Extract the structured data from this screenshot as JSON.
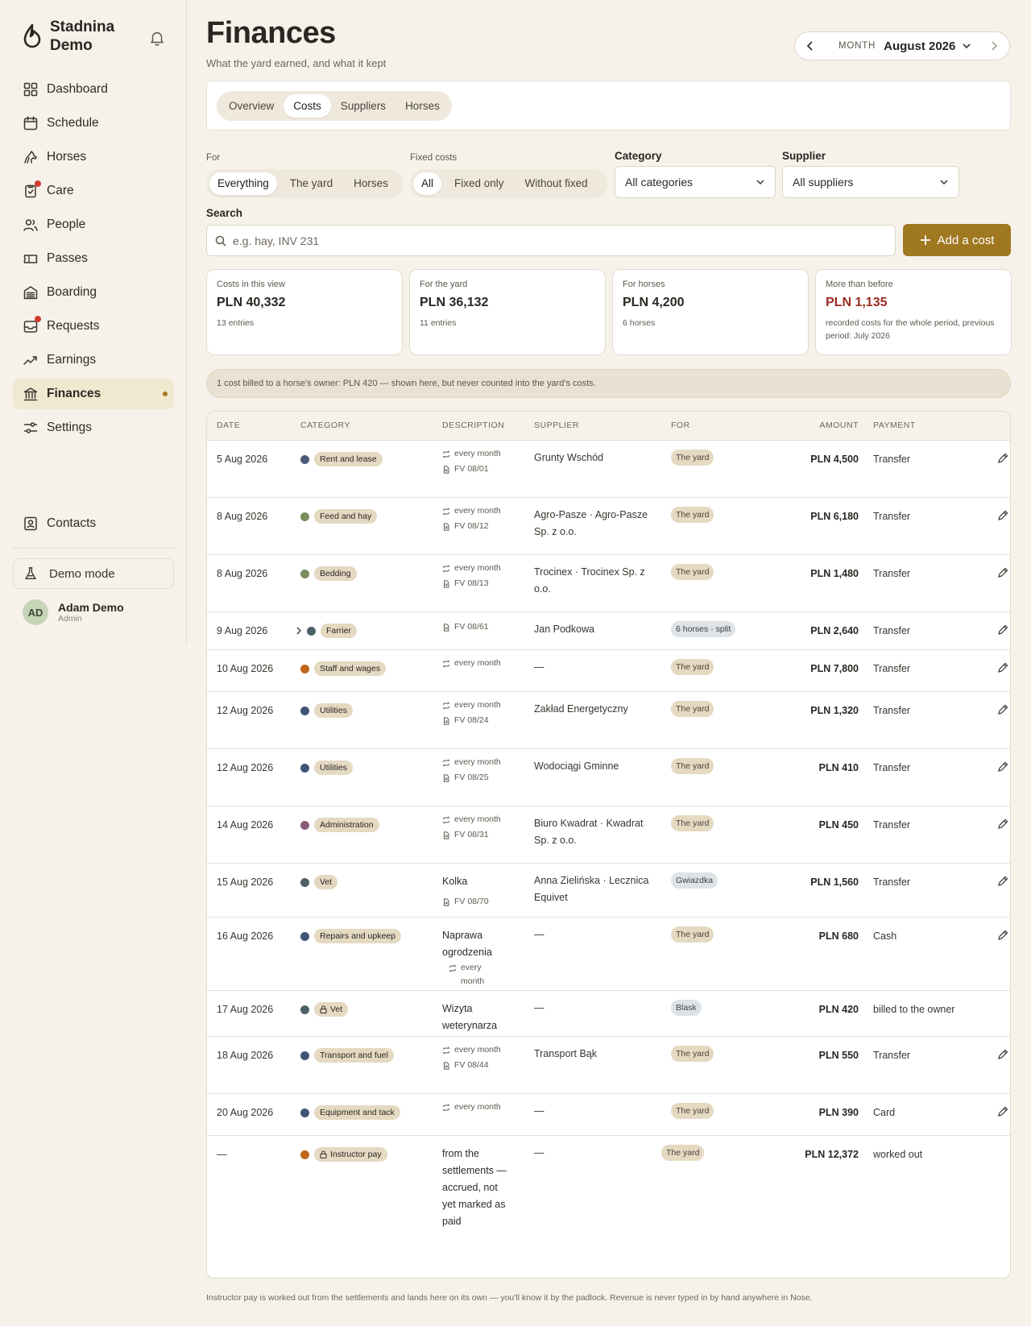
{
  "app": {
    "name": "Stadnina Demo"
  },
  "sidebar": {
    "items": [
      {
        "label": "Dashboard",
        "icon": "grid-icon"
      },
      {
        "label": "Schedule",
        "icon": "calendar-icon"
      },
      {
        "label": "Horses",
        "icon": "horse-icon"
      },
      {
        "label": "Care",
        "icon": "clipboard-icon"
      },
      {
        "label": "People",
        "icon": "people-icon"
      },
      {
        "label": "Passes",
        "icon": "ticket-icon"
      },
      {
        "label": "Boarding",
        "icon": "barn-icon"
      },
      {
        "label": "Requests",
        "icon": "inbox-icon"
      },
      {
        "label": "Earnings",
        "icon": "trend-icon"
      },
      {
        "label": "Finances",
        "icon": "bank-icon"
      },
      {
        "label": "Settings",
        "icon": "sliders-icon"
      }
    ],
    "contacts": "Contacts",
    "demo_mode": "Demo mode",
    "user": {
      "initials": "AD",
      "name": "Adam Demo",
      "role": "Admin"
    }
  },
  "header": {
    "title": "Finances",
    "subtitle": "What the yard earned, and what it kept",
    "month_label": "MONTH",
    "month_value": "August 2026"
  },
  "tabs": [
    "Overview",
    "Costs",
    "Suppliers",
    "Horses"
  ],
  "filters": {
    "for_label": "For",
    "for_options": [
      "Everything",
      "The yard",
      "Horses"
    ],
    "fixed_label": "Fixed costs",
    "fixed_options": [
      "All",
      "Fixed only",
      "Without fixed"
    ],
    "category_label": "Category",
    "category_value": "All categories",
    "supplier_label": "Supplier",
    "supplier_value": "All suppliers",
    "search_label": "Search",
    "search_placeholder": "e.g. hay, INV 231",
    "add_button": "Add a cost"
  },
  "stats": [
    {
      "label": "Costs in this view",
      "value": "PLN 40,332",
      "note": "13 entries"
    },
    {
      "label": "For the yard",
      "value": "PLN 36,132",
      "note": "11 entries"
    },
    {
      "label": "For horses",
      "value": "PLN 4,200",
      "note": "6 horses"
    },
    {
      "label": "More than before",
      "value": "PLN 1,135",
      "note": "recorded costs for the whole period, previous period: July 2026"
    }
  ],
  "banner": "1 cost billed to a horse's owner: PLN 420 — shown here, but never counted into the yard's costs.",
  "table": {
    "headers": [
      "DATE",
      "CATEGORY",
      "DESCRIPTION",
      "SUPPLIER",
      "FOR",
      "AMOUNT",
      "PAYMENT"
    ],
    "recurring": "every month",
    "rows": [
      {
        "date": "5 Aug 2026",
        "category": "Rent and lease",
        "color": "#4a5a78",
        "desc": "",
        "recurring": true,
        "invoice": "FV 08/01",
        "supplier": "Grunty Wschód",
        "for": "The yard",
        "for_type": "yard",
        "amount": "PLN 4,500",
        "payment": "Transfer"
      },
      {
        "date": "8 Aug 2026",
        "category": "Feed and hay",
        "color": "#7a8c5c",
        "desc": "",
        "recurring": true,
        "invoice": "FV 08/12",
        "supplier": "Agro-Pasze · Agro-Pasze Sp. z o.o.",
        "for": "The yard",
        "for_type": "yard",
        "amount": "PLN 6,180",
        "payment": "Transfer"
      },
      {
        "date": "8 Aug 2026",
        "category": "Bedding",
        "color": "#7a8c5c",
        "desc": "",
        "recurring": true,
        "invoice": "FV 08/13",
        "supplier": "Trocinex · Trocinex Sp. z o.o.",
        "for": "The yard",
        "for_type": "yard",
        "amount": "PLN 1,480",
        "payment": "Transfer"
      },
      {
        "date": "9 Aug 2026",
        "category": "Farrier",
        "color": "#4d6068",
        "desc": "",
        "recurring": false,
        "invoice": "FV 08/61",
        "supplier": "Jan Podkowa",
        "for": "6 horses · split",
        "for_type": "horse",
        "amount": "PLN 2,640",
        "payment": "Transfer"
      },
      {
        "date": "10 Aug 2026",
        "category": "Staff and wages",
        "color": "#c0661c",
        "desc": "",
        "recurring": true,
        "invoice": "",
        "supplier": "—",
        "for": "The yard",
        "for_type": "yard",
        "amount": "PLN 7,800",
        "payment": "Transfer"
      },
      {
        "date": "12 Aug 2026",
        "category": "Utilities",
        "color": "#3f5478",
        "desc": "",
        "recurring": true,
        "invoice": "FV 08/24",
        "supplier": "Zakład Energetyczny",
        "for": "The yard",
        "for_type": "yard",
        "amount": "PLN 1,320",
        "payment": "Transfer"
      },
      {
        "date": "12 Aug 2026",
        "category": "Utilities",
        "color": "#3f5478",
        "desc": "",
        "recurring": true,
        "invoice": "FV 08/25",
        "supplier": "Wodociągi Gminne",
        "for": "The yard",
        "for_type": "yard",
        "amount": "PLN 410",
        "payment": "Transfer"
      },
      {
        "date": "14 Aug 2026",
        "category": "Administration",
        "color": "#8a5c78",
        "desc": "",
        "recurring": true,
        "invoice": "FV 08/31",
        "supplier": "Biuro Kwadrat · Kwadrat Sp. z o.o.",
        "for": "The yard",
        "for_type": "yard",
        "amount": "PLN 450",
        "payment": "Transfer"
      },
      {
        "date": "15 Aug 2026",
        "category": "Vet",
        "color": "#4d6068",
        "desc": "Kolka",
        "recurring": false,
        "invoice": "FV 08/70",
        "supplier": "Anna Zielińska · Lecznica Equivet",
        "for": "Gwiazdka",
        "for_type": "horse",
        "amount": "PLN 1,560",
        "payment": "Transfer"
      },
      {
        "date": "16 Aug 2026",
        "category": "Repairs and upkeep",
        "color": "#3f5478",
        "desc": "Naprawa ogrodzenia",
        "recurring": true,
        "invoice": "",
        "supplier": "—",
        "for": "The yard",
        "for_type": "yard",
        "amount": "PLN 680",
        "payment": "Cash"
      },
      {
        "date": "17 Aug 2026",
        "category": "Vet",
        "color": "#4d6068",
        "lock": true,
        "desc": "Wizyta weterynarza",
        "recurring": false,
        "invoice": "",
        "supplier": "—",
        "for": "Blask",
        "for_type": "horse",
        "amount": "PLN 420",
        "payment": "billed to the owner",
        "no_edit": true
      },
      {
        "date": "18 Aug 2026",
        "category": "Transport and fuel",
        "color": "#3f5478",
        "desc": "",
        "recurring": true,
        "invoice": "FV 08/44",
        "supplier": "Transport Bąk",
        "for": "The yard",
        "for_type": "yard",
        "amount": "PLN 550",
        "payment": "Transfer"
      },
      {
        "date": "20 Aug 2026",
        "category": "Equipment and tack",
        "color": "#3f5478",
        "desc": "",
        "recurring": true,
        "invoice": "",
        "supplier": "—",
        "for": "The yard",
        "for_type": "yard",
        "amount": "PLN 390",
        "payment": "Card"
      },
      {
        "date": "—",
        "category": "Instructor pay",
        "color": "#c0661c",
        "lock": true,
        "desc": "from the settlements — accrued, not yet marked as paid",
        "recurring": false,
        "invoice": "",
        "supplier": "—",
        "for": "The yard",
        "for_type": "yard",
        "amount": "PLN 12,372",
        "payment": "worked out",
        "no_edit": true
      }
    ]
  },
  "footnote": "Instructor pay is worked out from the settlements and lands here on its own — you'll know it by the padlock. Revenue is never typed in by hand anywhere in Nose.",
  "colors": {
    "accent": "#a07820",
    "active_nav": "#f1e8d0",
    "negative": "#9a2a22"
  }
}
